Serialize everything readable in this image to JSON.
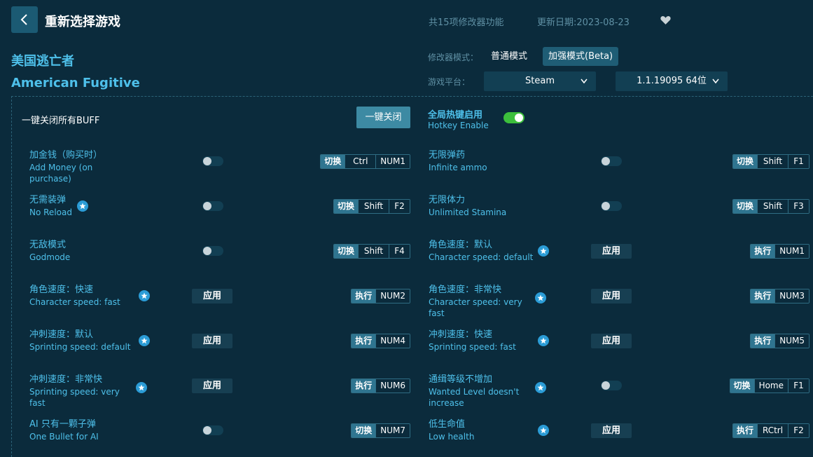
{
  "header": {
    "title": "重新选择游戏",
    "feature_count": "共15项修改器功能",
    "update_date": "更新日期:2023-08-23"
  },
  "game": {
    "name_cn": "美国逃亡者",
    "name_en": "American Fugitive"
  },
  "mode": {
    "label": "修改器模式：",
    "normal": "普通模式",
    "beta": "加强模式(Beta)"
  },
  "platform": {
    "label": "游戏平台：",
    "selected": "Steam",
    "version": "1.1.19095 64位"
  },
  "quick": {
    "label": "一键关闭所有BUFF",
    "button": "一键关闭"
  },
  "hotkey": {
    "label_cn": "全局热键启用",
    "label_en": "Hotkey Enable",
    "enabled": true
  },
  "features": [
    {
      "cn": "加金钱（购买时）",
      "en": "Add Money (on purchase)",
      "control": "toggle",
      "action": "切换",
      "keys": [
        "Ctrl",
        "NUM1"
      ]
    },
    {
      "cn": "无限弹药",
      "en": "Infinite ammo",
      "control": "toggle",
      "action": "切换",
      "keys": [
        "Shift",
        "F1"
      ]
    },
    {
      "cn": "无需装弹",
      "en": "No Reload",
      "control": "toggle",
      "starred": true,
      "action": "切换",
      "keys": [
        "Shift",
        "F2"
      ]
    },
    {
      "cn": "无限体力",
      "en": "Unlimited Stamina",
      "control": "toggle",
      "action": "切换",
      "keys": [
        "Shift",
        "F3"
      ]
    },
    {
      "cn": "无敌模式",
      "en": "Godmode",
      "control": "toggle",
      "action": "切换",
      "keys": [
        "Shift",
        "F4"
      ]
    },
    {
      "cn": "角色速度：默认",
      "en": "Character speed: default",
      "control": "apply",
      "apply_label": "应用",
      "starred": true,
      "action": "执行",
      "keys": [
        "NUM1"
      ]
    },
    {
      "cn": "角色速度：快速",
      "en": "Character speed: fast",
      "control": "apply",
      "apply_label": "应用",
      "starred": true,
      "action": "执行",
      "keys": [
        "NUM2"
      ]
    },
    {
      "cn": "角色速度：非常快",
      "en": "Character speed: very fast",
      "control": "apply",
      "apply_label": "应用",
      "starred": true,
      "action": "执行",
      "keys": [
        "NUM3"
      ]
    },
    {
      "cn": "冲刺速度：默认",
      "en": "Sprinting speed: default",
      "control": "apply",
      "apply_label": "应用",
      "starred": true,
      "action": "执行",
      "keys": [
        "NUM4"
      ]
    },
    {
      "cn": "冲刺速度：快速",
      "en": "Sprinting speed: fast",
      "control": "apply",
      "apply_label": "应用",
      "starred": true,
      "action": "执行",
      "keys": [
        "NUM5"
      ]
    },
    {
      "cn": "冲刺速度：非常快",
      "en": "Sprinting speed: very fast",
      "control": "apply",
      "apply_label": "应用",
      "starred": true,
      "action": "执行",
      "keys": [
        "NUM6"
      ]
    },
    {
      "cn": "通缉等级不增加",
      "en": "Wanted Level doesn't increase",
      "control": "toggle",
      "starred": true,
      "action": "切换",
      "keys": [
        "Home",
        "F1"
      ]
    },
    {
      "cn": "AI 只有一颗子弹",
      "en": "One Bullet for AI",
      "control": "toggle",
      "action": "切换",
      "keys": [
        "NUM7"
      ]
    },
    {
      "cn": "低生命值",
      "en": "Low health",
      "control": "apply",
      "apply_label": "应用",
      "starred": true,
      "action": "执行",
      "keys": [
        "RCtrl",
        "F2"
      ]
    }
  ]
}
